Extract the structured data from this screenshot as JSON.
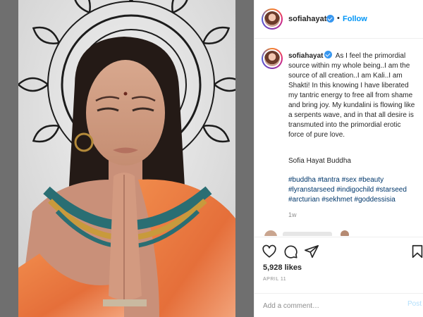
{
  "post": {
    "username": "sofiahayat",
    "follow_label": "Follow",
    "dot": "•",
    "caption_text": "As I feel the primordial source within my whole being..I am the source of all creation..I am Kali..I am Shakti! In this knowing I have liberated my tantric energy to free all from shame and bring joy. My kundalini is flowing like a serpents wave, and in that all desire is transmuted into the primordial erotic force of pure love.",
    "signature": "Sofia Hayat Buddha",
    "hashtags": [
      "#buddha",
      "#tantra",
      "#sex",
      "#beauty",
      "#lyranstarseed",
      "#indigochild",
      "#starseed",
      "#arcturian",
      "#sekhmet",
      "#goddessisia"
    ],
    "age": "1w",
    "likes": "5,928 likes",
    "date": "APRIL 11",
    "comment_placeholder": "Add a comment…",
    "post_label": "Post"
  },
  "icons": {
    "verified": "verified-badge-icon",
    "like": "heart-icon",
    "comment": "comment-bubble-icon",
    "share": "paper-plane-icon",
    "save": "bookmark-icon"
  },
  "colors": {
    "link_blue": "#0095f6",
    "hashtag": "#00376b",
    "muted": "#8e8e8e",
    "verified": "#3897f0"
  }
}
